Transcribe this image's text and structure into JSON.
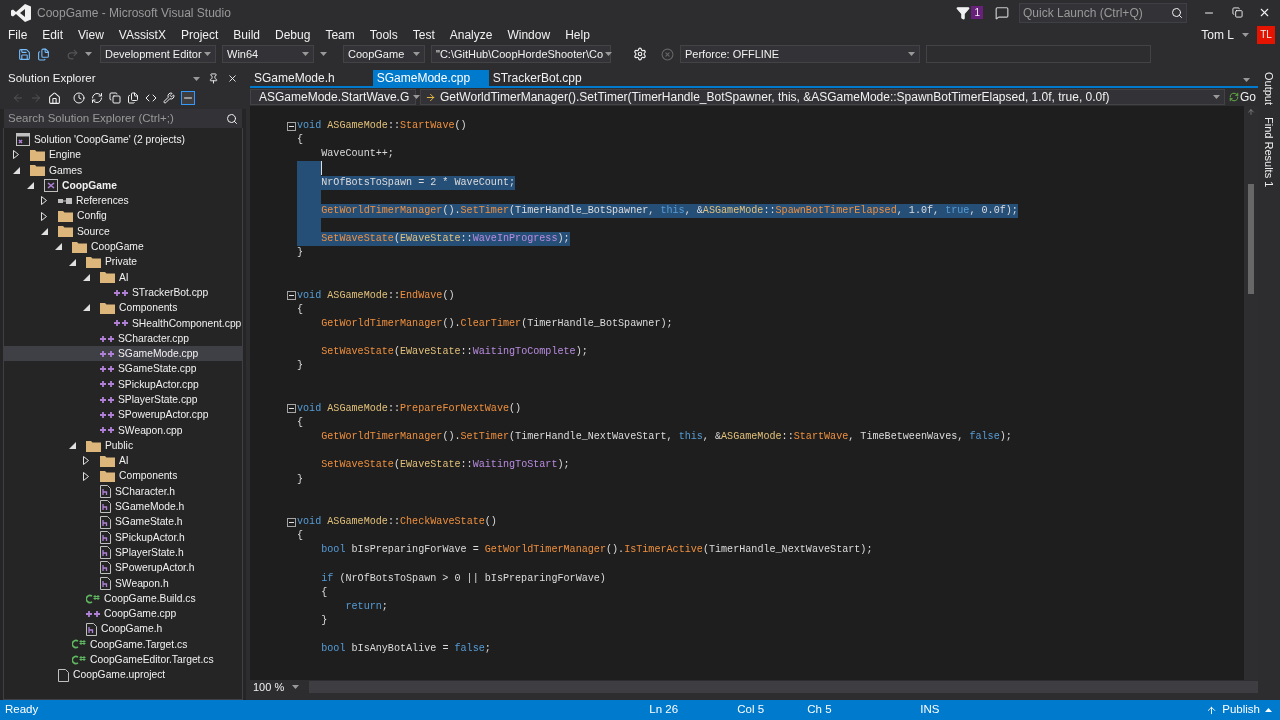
{
  "window": {
    "title": "CoopGame - Microsoft Visual Studio",
    "notification_count": "1",
    "quick_launch": {
      "placeholder": "Quick Launch (Ctrl+Q)"
    }
  },
  "menu": [
    "File",
    "Edit",
    "View",
    "VAssistX",
    "Project",
    "Build",
    "Debug",
    "Team",
    "Tools",
    "Test",
    "Analyze",
    "Window",
    "Help"
  ],
  "account": {
    "name": "Tom L",
    "initials": "TL"
  },
  "toolbar": {
    "configuration": "Development Editor",
    "platform": "Win64",
    "startup_project": "CoopGame",
    "command_args": "\"C:\\GitHub\\CoopHordeShooter\\Co",
    "source_control": "Perforce: OFFLINE"
  },
  "solution_explorer": {
    "title": "Solution Explorer",
    "search": {
      "placeholder": "Search Solution Explorer (Ctrl+;)"
    },
    "tree": [
      {
        "label": "Solution 'CoopGame' (2 projects)",
        "kind": "solution",
        "selected": false,
        "children": [
          {
            "label": "Engine",
            "kind": "folder",
            "selected": false,
            "expanded": false
          },
          {
            "label": "Games",
            "kind": "folder",
            "selected": false,
            "expanded": true,
            "children": [
              {
                "label": "CoopGame",
                "kind": "project",
                "selected": false,
                "expanded": true,
                "children": [
                  {
                    "label": "References",
                    "kind": "references",
                    "selected": false,
                    "expanded": false
                  },
                  {
                    "label": "Config",
                    "kind": "folder",
                    "selected": false,
                    "expanded": false
                  },
                  {
                    "label": "Source",
                    "kind": "folder",
                    "selected": false,
                    "expanded": true,
                    "children": [
                      {
                        "label": "CoopGame",
                        "kind": "folder",
                        "selected": false,
                        "expanded": true,
                        "children": [
                          {
                            "label": "Private",
                            "kind": "folder",
                            "selected": false,
                            "expanded": true,
                            "children": [
                              {
                                "label": "AI",
                                "kind": "folder",
                                "selected": false,
                                "expanded": true,
                                "children": [
                                  {
                                    "label": "STrackerBot.cpp",
                                    "kind": "cpp",
                                    "selected": false
                                  }
                                ]
                              },
                              {
                                "label": "Components",
                                "kind": "folder",
                                "selected": false,
                                "expanded": true,
                                "children": [
                                  {
                                    "label": "SHealthComponent.cpp",
                                    "kind": "cpp",
                                    "selected": false
                                  }
                                ]
                              },
                              {
                                "label": "SCharacter.cpp",
                                "kind": "cpp",
                                "selected": false
                              },
                              {
                                "label": "SGameMode.cpp",
                                "kind": "cpp",
                                "selected": true
                              },
                              {
                                "label": "SGameState.cpp",
                                "kind": "cpp",
                                "selected": false
                              },
                              {
                                "label": "SPickupActor.cpp",
                                "kind": "cpp",
                                "selected": false
                              },
                              {
                                "label": "SPlayerState.cpp",
                                "kind": "cpp",
                                "selected": false
                              },
                              {
                                "label": "SPowerupActor.cpp",
                                "kind": "cpp",
                                "selected": false
                              },
                              {
                                "label": "SWeapon.cpp",
                                "kind": "cpp",
                                "selected": false
                              }
                            ]
                          },
                          {
                            "label": "Public",
                            "kind": "folder",
                            "selected": false,
                            "expanded": true,
                            "children": [
                              {
                                "label": "AI",
                                "kind": "folder",
                                "selected": false,
                                "expanded": false
                              },
                              {
                                "label": "Components",
                                "kind": "folder",
                                "selected": false,
                                "expanded": false
                              },
                              {
                                "label": "SCharacter.h",
                                "kind": "h",
                                "selected": false
                              },
                              {
                                "label": "SGameMode.h",
                                "kind": "h",
                                "selected": false
                              },
                              {
                                "label": "SGameState.h",
                                "kind": "h",
                                "selected": false
                              },
                              {
                                "label": "SPickupActor.h",
                                "kind": "h",
                                "selected": false
                              },
                              {
                                "label": "SPlayerState.h",
                                "kind": "h",
                                "selected": false
                              },
                              {
                                "label": "SPowerupActor.h",
                                "kind": "h",
                                "selected": false
                              },
                              {
                                "label": "SWeapon.h",
                                "kind": "h",
                                "selected": false
                              }
                            ]
                          },
                          {
                            "label": "CoopGame.Build.cs",
                            "kind": "cs",
                            "selected": false
                          },
                          {
                            "label": "CoopGame.cpp",
                            "kind": "cpp",
                            "selected": false
                          },
                          {
                            "label": "CoopGame.h",
                            "kind": "h",
                            "selected": false
                          }
                        ]
                      },
                      {
                        "label": "CoopGame.Target.cs",
                        "kind": "cs",
                        "selected": false
                      },
                      {
                        "label": "CoopGameEditor.Target.cs",
                        "kind": "cs",
                        "selected": false
                      }
                    ]
                  },
                  {
                    "label": "CoopGame.uproject",
                    "kind": "file",
                    "selected": false
                  }
                ]
              }
            ]
          }
        ]
      }
    ]
  },
  "editor": {
    "tabs": [
      {
        "label": "SGameMode.h",
        "selected": false
      },
      {
        "label": "SGameMode.cpp",
        "selected": true
      },
      {
        "label": "STrackerBot.cpp",
        "selected": false
      }
    ],
    "scope": "ASGameMode.StartWave.G",
    "member": "GetWorldTimerManager().SetTimer(TimerHandle_BotSpawner, this, &ASGameMode::SpawnBotTimerElapsed, 1.0f, true, 0.0f)",
    "go": "Go",
    "zoom": "100 %",
    "lines": [
      {
        "kind": "signature",
        "selected": false,
        "tokens": [
          {
            "kind": "kw",
            "text": "void "
          },
          {
            "kind": "type",
            "text": "ASGameMode"
          },
          {
            "kind": "p",
            "text": "::"
          },
          {
            "kind": "fn",
            "text": "StartWave"
          },
          {
            "kind": "p",
            "text": "()"
          }
        ]
      },
      {
        "selected": false,
        "tokens": [
          {
            "kind": "p",
            "text": "{"
          }
        ]
      },
      {
        "selected": false,
        "tokens": [
          {
            "kind": "p",
            "text": "    WaveCount++;"
          }
        ]
      },
      {
        "selected": true,
        "caret": true
      },
      {
        "selected": true,
        "tokens": [
          {
            "kind": "p",
            "text": "    NrOfBotsToSpawn = 2 * WaveCount;"
          }
        ]
      },
      {
        "selected": true
      },
      {
        "selected": true,
        "tokens": [
          {
            "kind": "fn",
            "text": "    GetWorldTimerManager"
          },
          {
            "kind": "p",
            "text": "()."
          },
          {
            "kind": "fn",
            "text": "SetTimer"
          },
          {
            "kind": "p",
            "text": "(TimerHandle_BotSpawner, "
          },
          {
            "kind": "kw",
            "text": "this"
          },
          {
            "kind": "p",
            "text": ", &"
          },
          {
            "kind": "type",
            "text": "ASGameMode"
          },
          {
            "kind": "p",
            "text": "::"
          },
          {
            "kind": "fn",
            "text": "SpawnBotTimerElapsed"
          },
          {
            "kind": "p",
            "text": ", 1.0f, "
          },
          {
            "kind": "kw",
            "text": "true"
          },
          {
            "kind": "p",
            "text": ", 0.0f);"
          }
        ]
      },
      {
        "selected": true
      },
      {
        "selected": true,
        "tokens": [
          {
            "kind": "fn",
            "text": "    SetWaveState"
          },
          {
            "kind": "p",
            "text": "("
          },
          {
            "kind": "type",
            "text": "EWaveState"
          },
          {
            "kind": "p",
            "text": "::"
          },
          {
            "kind": "enum",
            "text": "WaveInProgress"
          },
          {
            "kind": "p",
            "text": ");"
          }
        ]
      },
      {
        "selected": false,
        "tokens": [
          {
            "kind": "p",
            "text": "}"
          }
        ]
      },
      {
        "selected": false
      },
      {
        "selected": false
      },
      {
        "kind": "signature",
        "selected": false,
        "tokens": [
          {
            "kind": "kw",
            "text": "void "
          },
          {
            "kind": "type",
            "text": "ASGameMode"
          },
          {
            "kind": "p",
            "text": "::"
          },
          {
            "kind": "fn",
            "text": "EndWave"
          },
          {
            "kind": "p",
            "text": "()"
          }
        ]
      },
      {
        "selected": false,
        "tokens": [
          {
            "kind": "p",
            "text": "{"
          }
        ]
      },
      {
        "selected": false,
        "tokens": [
          {
            "kind": "fn",
            "text": "    GetWorldTimerManager"
          },
          {
            "kind": "p",
            "text": "()."
          },
          {
            "kind": "fn",
            "text": "ClearTimer"
          },
          {
            "kind": "p",
            "text": "(TimerHandle_BotSpawner);"
          }
        ]
      },
      {
        "selected": false
      },
      {
        "selected": false,
        "tokens": [
          {
            "kind": "fn",
            "text": "    SetWaveState"
          },
          {
            "kind": "p",
            "text": "("
          },
          {
            "kind": "type",
            "text": "EWaveState"
          },
          {
            "kind": "p",
            "text": "::"
          },
          {
            "kind": "enum",
            "text": "WaitingToComplete"
          },
          {
            "kind": "p",
            "text": ");"
          }
        ]
      },
      {
        "selected": false,
        "tokens": [
          {
            "kind": "p",
            "text": "}"
          }
        ]
      },
      {
        "selected": false
      },
      {
        "selected": false
      },
      {
        "kind": "signature",
        "selected": false,
        "tokens": [
          {
            "kind": "kw",
            "text": "void "
          },
          {
            "kind": "type",
            "text": "ASGameMode"
          },
          {
            "kind": "p",
            "text": "::"
          },
          {
            "kind": "fn",
            "text": "PrepareForNextWave"
          },
          {
            "kind": "p",
            "text": "()"
          }
        ]
      },
      {
        "selected": false,
        "tokens": [
          {
            "kind": "p",
            "text": "{"
          }
        ]
      },
      {
        "selected": false,
        "tokens": [
          {
            "kind": "fn",
            "text": "    GetWorldTimerManager"
          },
          {
            "kind": "p",
            "text": "()."
          },
          {
            "kind": "fn",
            "text": "SetTimer"
          },
          {
            "kind": "p",
            "text": "(TimerHandle_NextWaveStart, "
          },
          {
            "kind": "kw",
            "text": "this"
          },
          {
            "kind": "p",
            "text": ", &"
          },
          {
            "kind": "type",
            "text": "ASGameMode"
          },
          {
            "kind": "p",
            "text": "::"
          },
          {
            "kind": "fn",
            "text": "StartWave"
          },
          {
            "kind": "p",
            "text": ", TimeBetweenWaves, "
          },
          {
            "kind": "kw",
            "text": "false"
          },
          {
            "kind": "p",
            "text": ");"
          }
        ]
      },
      {
        "selected": false
      },
      {
        "selected": false,
        "tokens": [
          {
            "kind": "fn",
            "text": "    SetWaveState"
          },
          {
            "kind": "p",
            "text": "("
          },
          {
            "kind": "type",
            "text": "EWaveState"
          },
          {
            "kind": "p",
            "text": "::"
          },
          {
            "kind": "enum",
            "text": "WaitingToStart"
          },
          {
            "kind": "p",
            "text": ");"
          }
        ]
      },
      {
        "selected": false,
        "tokens": [
          {
            "kind": "p",
            "text": "}"
          }
        ]
      },
      {
        "selected": false
      },
      {
        "selected": false
      },
      {
        "kind": "signature",
        "selected": false,
        "tokens": [
          {
            "kind": "kw",
            "text": "void "
          },
          {
            "kind": "type",
            "text": "ASGameMode"
          },
          {
            "kind": "p",
            "text": "::"
          },
          {
            "kind": "fn",
            "text": "CheckWaveState"
          },
          {
            "kind": "p",
            "text": "()"
          }
        ]
      },
      {
        "selected": false,
        "tokens": [
          {
            "kind": "p",
            "text": "{"
          }
        ]
      },
      {
        "selected": false,
        "tokens": [
          {
            "kind": "kw",
            "text": "    bool"
          },
          {
            "kind": "p",
            "text": " bIsPreparingForWave = "
          },
          {
            "kind": "fn",
            "text": "GetWorldTimerManager"
          },
          {
            "kind": "p",
            "text": "()."
          },
          {
            "kind": "fn",
            "text": "IsTimerActive"
          },
          {
            "kind": "p",
            "text": "(TimerHandle_NextWaveStart);"
          }
        ]
      },
      {
        "selected": false
      },
      {
        "selected": false,
        "tokens": [
          {
            "kind": "kw",
            "text": "    if"
          },
          {
            "kind": "p",
            "text": " (NrOfBotsToSpawn > 0 || bIsPreparingForWave)"
          }
        ]
      },
      {
        "selected": false,
        "tokens": [
          {
            "kind": "p",
            "text": "    {"
          }
        ]
      },
      {
        "selected": false,
        "tokens": [
          {
            "kind": "kw",
            "text": "        return"
          },
          {
            "kind": "p",
            "text": ";"
          }
        ]
      },
      {
        "selected": false,
        "tokens": [
          {
            "kind": "p",
            "text": "    }"
          }
        ]
      },
      {
        "selected": false
      },
      {
        "selected": false,
        "tokens": [
          {
            "kind": "kw",
            "text": "    bool"
          },
          {
            "kind": "p",
            "text": " bIsAnyBotAlive = "
          },
          {
            "kind": "kw",
            "text": "false"
          },
          {
            "kind": "p",
            "text": ";"
          }
        ]
      }
    ]
  },
  "side_tabs": [
    "Output",
    "Find Results 1"
  ],
  "status_bar": {
    "state": "Ready",
    "line": "Ln 26",
    "column": "Col 5",
    "char": "Ch 5",
    "mode": "INS",
    "publish": "Publish"
  }
}
